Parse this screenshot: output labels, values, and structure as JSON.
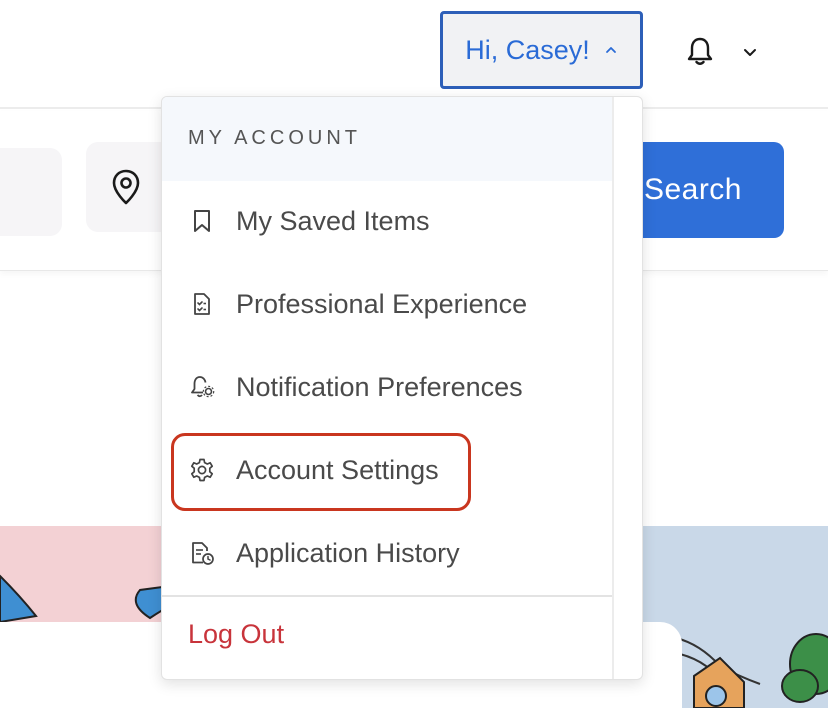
{
  "header": {
    "greeting": "Hi, Casey!",
    "greeting_chevron_icon": "chevron-up-icon",
    "bell_icon": "bell-icon",
    "notif_chevron_icon": "chevron-down-icon"
  },
  "search": {
    "button_label": "Search",
    "location_icon": "map-pin-icon"
  },
  "dropdown": {
    "section_title": "MY ACCOUNT",
    "items": [
      {
        "label": "My Saved Items",
        "icon": "bookmark-icon"
      },
      {
        "label": "Professional Experience",
        "icon": "document-checklist-icon"
      },
      {
        "label": "Notification Preferences",
        "icon": "bell-settings-icon"
      },
      {
        "label": "Account Settings",
        "icon": "gear-icon",
        "highlighted": true
      },
      {
        "label": "Application History",
        "icon": "document-clock-icon"
      }
    ],
    "logout_label": "Log Out"
  },
  "colors": {
    "accent_blue": "#2f6fd8",
    "greeting_border": "#2d5fb8",
    "logout_red": "#c8343b",
    "highlight_ring": "#c9361f"
  }
}
